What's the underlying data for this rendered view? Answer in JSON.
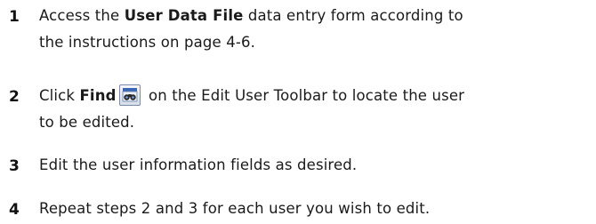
{
  "steps": [
    {
      "number": "1",
      "part1": "Access the ",
      "bold": "User Data File",
      "part2": " data entry form according to",
      "line2": "the instructions on page 4-6."
    },
    {
      "number": "2",
      "part1": "Click ",
      "bold": "Find",
      "icon": "find-binoculars-icon",
      "part2": " on the Edit User Toolbar to locate the user",
      "line2": "to be edited."
    },
    {
      "number": "3",
      "text": "Edit the user information fields as desired."
    },
    {
      "number": "4",
      "text": "Repeat steps 2 and 3 for each user you wish to edit."
    }
  ]
}
